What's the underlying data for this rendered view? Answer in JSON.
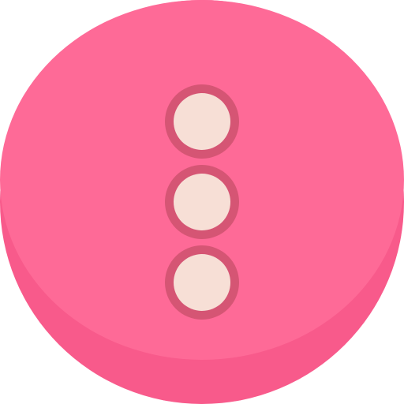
{
  "icon": {
    "name": "more-options-vertical-icon",
    "colors": {
      "button_face": "#fe6a97",
      "button_rim": "#f85a8b",
      "dot_fill": "#f7dfd6",
      "dot_ring": "#d55574"
    },
    "dot_count": 3
  }
}
